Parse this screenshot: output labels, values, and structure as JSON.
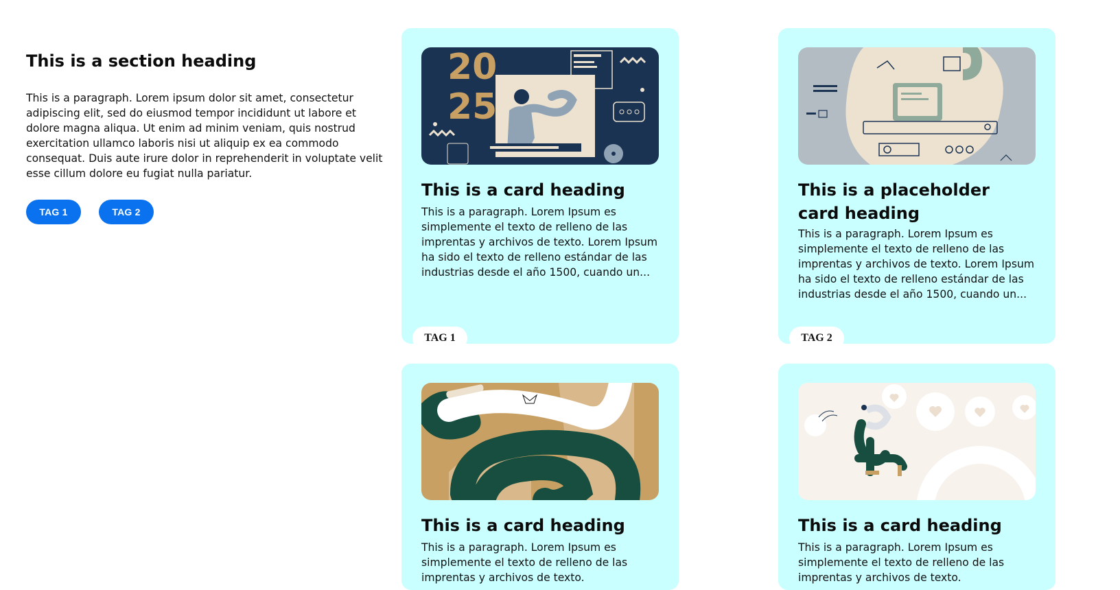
{
  "section": {
    "heading": "This is a section heading",
    "paragraph": "This is a paragraph. Lorem ipsum dolor sit amet, consectetur adipiscing elit, sed do eiusmod tempor incididunt ut labore et dolore magna aliqua. Ut enim ad minim veniam, quis nostrud exercitation ullamco laboris nisi ut aliquip ex ea commodo consequat. Duis aute irure dolor in reprehenderit in voluptate velit esse cillum dolore eu fugiat nulla pariatur.",
    "tags": [
      "TAG 1",
      "TAG 2"
    ]
  },
  "cards": [
    {
      "heading": "This is a card heading",
      "paragraph": "This is a paragraph. Lorem Ipsum es simplemente el texto de relleno de las imprentas y archivos de texto. Lorem Ipsum ha sido el texto de relleno estándar de las industrias desde el año 1500, cuando un...",
      "tag": "TAG 1",
      "image_text": [
        "20",
        "25"
      ]
    },
    {
      "heading": "This is a placeholder card heading",
      "paragraph": "This is a paragraph. Lorem Ipsum es simplemente el texto de relleno de las imprentas y archivos de texto. Lorem Ipsum ha sido el texto de relleno estándar de las industrias desde el año 1500, cuando un...",
      "tag": "TAG 2"
    },
    {
      "heading": "This is a card heading",
      "paragraph": "This is a paragraph. Lorem Ipsum es simplemente el texto de relleno de las imprentas y archivos de texto."
    },
    {
      "heading": "This is a card heading",
      "paragraph": "This is a paragraph. Lorem Ipsum es simplemente el texto de relleno de las imprentas y archivos de texto."
    }
  ],
  "colors": {
    "card_bg": "#c9ffff",
    "tag_blue": "#0a72ee",
    "navy": "#1b3353",
    "tan": "#c9a063",
    "dark_green": "#184e3f"
  }
}
